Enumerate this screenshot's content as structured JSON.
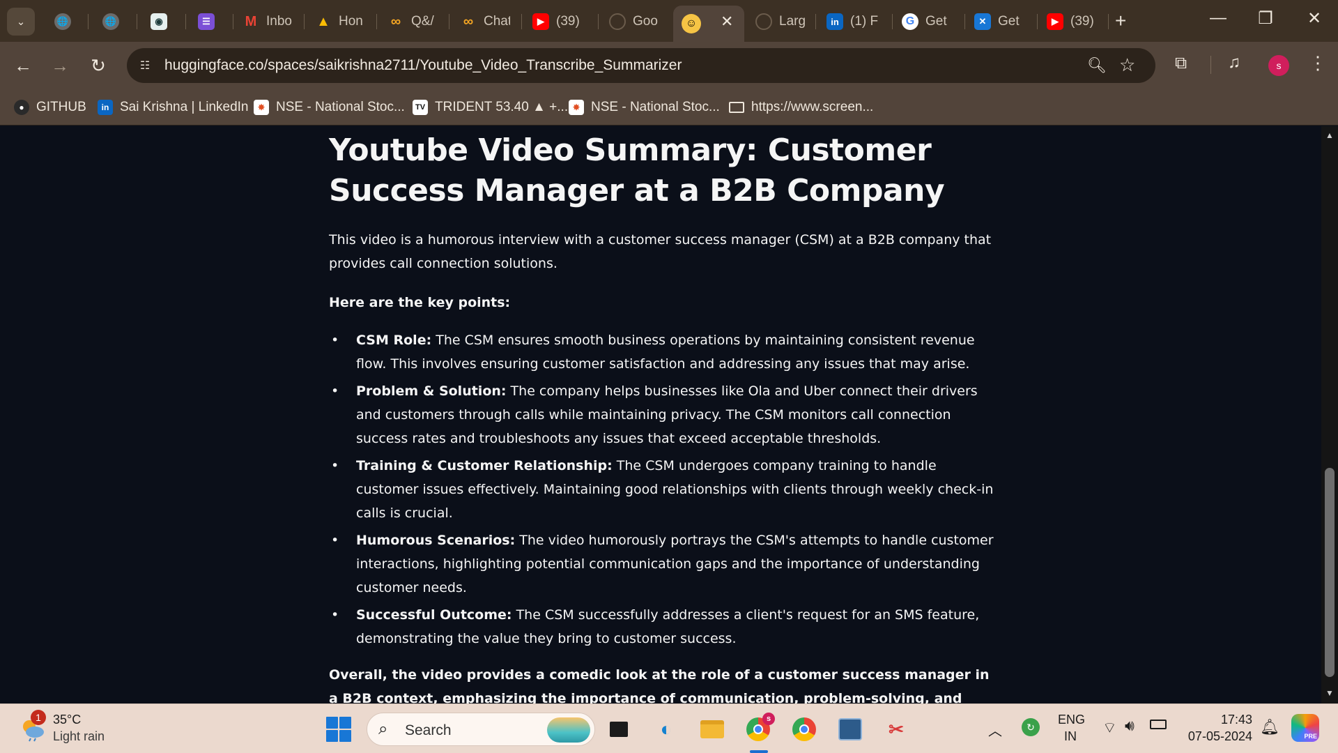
{
  "browser": {
    "tabs": [
      {
        "title": "",
        "icon": "globe-icon"
      },
      {
        "title": "",
        "icon": "globe-icon"
      },
      {
        "title": "",
        "icon": "game-icon"
      },
      {
        "title": "",
        "icon": "list-icon"
      },
      {
        "title": "Inbo",
        "icon": "gmail-icon"
      },
      {
        "title": "Hon",
        "icon": "drive-icon"
      },
      {
        "title": "Q&/",
        "icon": "infinity-icon"
      },
      {
        "title": "Chat",
        "icon": "infinity-icon"
      },
      {
        "title": "(39)",
        "icon": "youtube-icon"
      },
      {
        "title": "Goo",
        "icon": "loading-icon"
      },
      {
        "title": "",
        "icon": "huggingface-icon",
        "active": true
      },
      {
        "title": "Larg",
        "icon": "loading-icon"
      },
      {
        "title": "(1) F",
        "icon": "linkedin-icon"
      },
      {
        "title": "Get",
        "icon": "google-icon"
      },
      {
        "title": "Get",
        "icon": "butterfly-icon"
      },
      {
        "title": "(39)",
        "icon": "youtube-icon"
      }
    ],
    "close_glyph": "✕",
    "new_tab_glyph": "+",
    "window_controls": {
      "minimize": "—",
      "restore": "❐",
      "close": "✕"
    },
    "url": "huggingface.co/spaces/saikrishna2711/Youtube_Video_Transcribe_Summarizer",
    "profile_initial": "s",
    "bookmarks": [
      {
        "label": "GITHUB",
        "icon": "github-icon"
      },
      {
        "label": "Sai Krishna | LinkedIn",
        "icon": "linkedin-icon"
      },
      {
        "label": "NSE - National Stoc...",
        "icon": "nse-icon"
      },
      {
        "label": "TRIDENT 53.40 ▲ +...",
        "icon": "tradingview-icon"
      },
      {
        "label": "NSE - National Stoc...",
        "icon": "nse-icon"
      },
      {
        "label": "https://www.screen...",
        "icon": "folder-icon"
      }
    ]
  },
  "page": {
    "title": "Youtube Video Summary: Customer Success Manager at a B2B Company",
    "intro": "This video is a humorous interview with a customer success manager (CSM) at a B2B company that provides call connection solutions.",
    "key_points_heading": "Here are the key points:",
    "points": [
      {
        "label": "CSM Role:",
        "text": " The CSM ensures smooth business operations by maintaining consistent revenue flow. This involves ensuring customer satisfaction and addressing any issues that may arise."
      },
      {
        "label": "Problem & Solution:",
        "text": " The company helps businesses like Ola and Uber connect their drivers and customers through calls while maintaining privacy. The CSM monitors call connection success rates and troubleshoots any issues that exceed acceptable thresholds."
      },
      {
        "label": "Training & Customer Relationship:",
        "text": " The CSM undergoes company training to handle customer issues effectively. Maintaining good relationships with clients through weekly check-in calls is crucial."
      },
      {
        "label": "Humorous Scenarios:",
        "text": " The video humorously portrays the CSM's attempts to handle customer interactions, highlighting potential communication gaps and the importance of understanding customer needs."
      },
      {
        "label": "Successful Outcome:",
        "text": " The CSM successfully addresses a client's request for an SMS feature, demonstrating the value they bring to customer success."
      }
    ],
    "conclusion": "Overall, the video provides a comedic look at the role of a customer success manager in a B2B context, emphasizing the importance of communication, problem-solving, and building strong customer relationships."
  },
  "taskbar": {
    "weather": {
      "temp": "35°C",
      "desc": "Light rain",
      "badge": "1"
    },
    "search_label": "Search",
    "language": {
      "line1": "ENG",
      "line2": "IN"
    },
    "clock": {
      "time": "17:43",
      "date": "07-05-2024"
    },
    "copilot_badge": "PRE",
    "chrome_badge": "s"
  },
  "colors": {
    "page_background": "#0b0f19",
    "browser_frame": "#52443a",
    "taskbar": "#ebd9ce",
    "avatar": "#d01e5c"
  }
}
